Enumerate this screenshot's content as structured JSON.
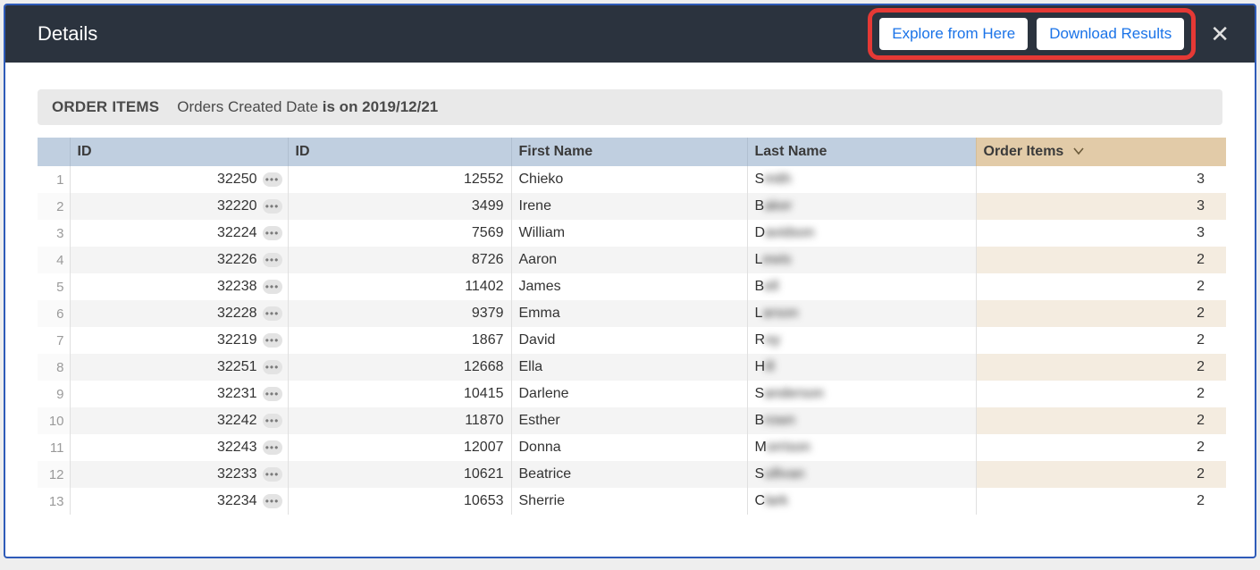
{
  "header": {
    "title": "Details",
    "explore_label": "Explore from Here",
    "download_label": "Download Results"
  },
  "filter": {
    "group_label": "ORDER ITEMS",
    "prefix": "Orders Created Date ",
    "suffix": "is on 2019/12/21"
  },
  "columns": {
    "id1": "ID",
    "id2": "ID",
    "first": "First Name",
    "last": "Last Name",
    "items": "Order Items"
  },
  "rows": [
    {
      "n": "1",
      "id1": "32250",
      "id2": "12552",
      "first": "Chieko",
      "last_i": "S",
      "last_rest": "mith",
      "items": "3"
    },
    {
      "n": "2",
      "id1": "32220",
      "id2": "3499",
      "first": "Irene",
      "last_i": "B",
      "last_rest": "aker",
      "items": "3"
    },
    {
      "n": "3",
      "id1": "32224",
      "id2": "7569",
      "first": "William",
      "last_i": "D",
      "last_rest": "avidson",
      "items": "3"
    },
    {
      "n": "4",
      "id1": "32226",
      "id2": "8726",
      "first": "Aaron",
      "last_i": "L",
      "last_rest": "ewis",
      "items": "2"
    },
    {
      "n": "5",
      "id1": "32238",
      "id2": "11402",
      "first": "James",
      "last_i": "B",
      "last_rest": "ell",
      "items": "2"
    },
    {
      "n": "6",
      "id1": "32228",
      "id2": "9379",
      "first": "Emma",
      "last_i": "L",
      "last_rest": "arson",
      "items": "2"
    },
    {
      "n": "7",
      "id1": "32219",
      "id2": "1867",
      "first": "David",
      "last_i": "R",
      "last_rest": "oy",
      "items": "2"
    },
    {
      "n": "8",
      "id1": "32251",
      "id2": "12668",
      "first": "Ella",
      "last_i": "H",
      "last_rest": "ill",
      "items": "2"
    },
    {
      "n": "9",
      "id1": "32231",
      "id2": "10415",
      "first": "Darlene",
      "last_i": "S",
      "last_rest": "anderson",
      "items": "2"
    },
    {
      "n": "10",
      "id1": "32242",
      "id2": "11870",
      "first": "Esther",
      "last_i": "B",
      "last_rest": "rown",
      "items": "2"
    },
    {
      "n": "11",
      "id1": "32243",
      "id2": "12007",
      "first": "Donna",
      "last_i": "M",
      "last_rest": "orrison",
      "items": "2"
    },
    {
      "n": "12",
      "id1": "32233",
      "id2": "10621",
      "first": "Beatrice",
      "last_i": "S",
      "last_rest": "ullivan",
      "items": "2"
    },
    {
      "n": "13",
      "id1": "32234",
      "id2": "10653",
      "first": "Sherrie",
      "last_i": "C",
      "last_rest": "lark",
      "items": "2"
    }
  ]
}
